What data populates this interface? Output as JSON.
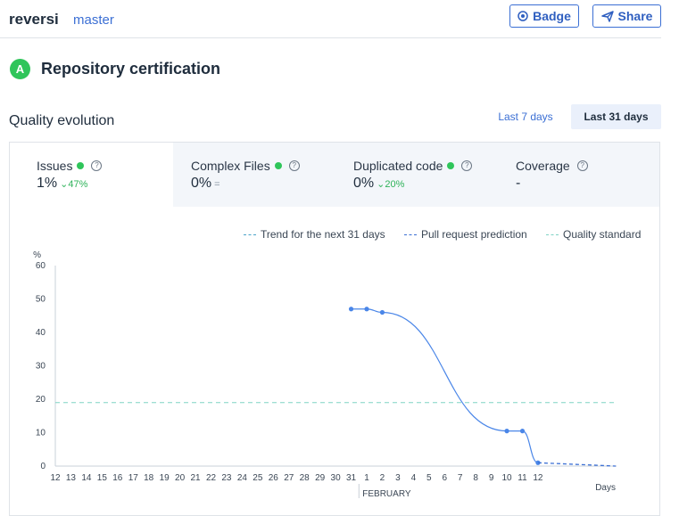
{
  "header": {
    "repo_name": "reversi",
    "branch": "master",
    "badge_label": "Badge",
    "share_label": "Share"
  },
  "certification": {
    "grade": "A",
    "title": "Repository certification"
  },
  "quality": {
    "title": "Quality evolution",
    "ranges": [
      {
        "label": "Last 7 days",
        "selected": false
      },
      {
        "label": "Last 31 days",
        "selected": true
      }
    ]
  },
  "metrics": [
    {
      "name": "Issues",
      "status": "ok",
      "value": "1%",
      "delta": "47%",
      "delta_icon": "arrow-down",
      "active": true
    },
    {
      "name": "Complex Files",
      "status": "ok",
      "value": "0%",
      "delta": "=",
      "delta_icon": "equal",
      "active": false
    },
    {
      "name": "Duplicated code",
      "status": "ok",
      "value": "0%",
      "delta": "20%",
      "delta_icon": "arrow-down",
      "active": false
    },
    {
      "name": "Coverage",
      "status": "none",
      "value": "-",
      "delta": "",
      "delta_icon": "",
      "active": false
    }
  ],
  "legend": [
    {
      "label": "Trend for the next 31 days",
      "color": "#4aa3c9"
    },
    {
      "label": "Pull request prediction",
      "color": "#3b6fd4"
    },
    {
      "label": "Quality standard",
      "color": "#7fd3c4"
    }
  ],
  "colors": {
    "accent": "#3b6fd4",
    "grade_a": "#2fc55a",
    "line": "#4a86e8",
    "standard": "#7fd3c4"
  },
  "chart_data": {
    "type": "line",
    "ylabel": "%",
    "xlabel": "Days",
    "x_month_label": "FEBRUARY",
    "ylim": [
      0,
      60
    ],
    "yticks": [
      0,
      10,
      20,
      30,
      40,
      50,
      60
    ],
    "categories": [
      "12",
      "13",
      "14",
      "15",
      "16",
      "17",
      "18",
      "19",
      "20",
      "21",
      "22",
      "23",
      "24",
      "25",
      "26",
      "27",
      "28",
      "29",
      "30",
      "31",
      "1",
      "2",
      "3",
      "4",
      "5",
      "6",
      "7",
      "8",
      "9",
      "10",
      "11",
      "12"
    ],
    "series": [
      {
        "kind": "actual",
        "points": [
          {
            "x": "31",
            "y": 47
          },
          {
            "x": "1",
            "y": 47
          },
          {
            "x": "2",
            "y": 46
          },
          {
            "x": "10",
            "y": 10.5
          },
          {
            "x": "11",
            "y": 10.5
          },
          {
            "x": "12",
            "y": 1
          }
        ]
      },
      {
        "kind": "trend",
        "points": [
          {
            "x": "12",
            "y": 1
          },
          {
            "x": "17",
            "y": 0
          }
        ]
      }
    ],
    "quality_standard": 19,
    "grid": false,
    "legend_position": "top-right"
  }
}
